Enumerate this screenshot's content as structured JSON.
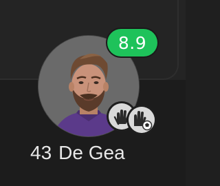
{
  "player": {
    "number": "43",
    "name": "De Gea",
    "rating": "8.9",
    "avatar_icon": "player-photo",
    "rating_color": "#1ec25a",
    "events": [
      {
        "icon": "save-hand-icon"
      },
      {
        "icon": "glove-ball-icon"
      }
    ]
  }
}
